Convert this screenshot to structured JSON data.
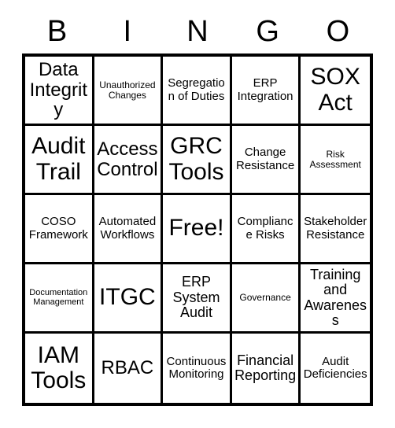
{
  "card": {
    "title": "BINGO",
    "header_letters": [
      "B",
      "I",
      "N",
      "G",
      "O"
    ],
    "free_space_label": "Free!",
    "colors": {
      "background": "#ffffff",
      "grid_line": "#000000",
      "text": "#000000"
    },
    "grid": {
      "rows": 5,
      "columns": 5,
      "cells": [
        {
          "text": "Data Integrity",
          "size": "lg",
          "free": false
        },
        {
          "text": "Unauthorized Changes",
          "size": "xs",
          "free": false
        },
        {
          "text": "Segregation of Duties",
          "size": "sm",
          "free": false
        },
        {
          "text": "ERP Integration",
          "size": "sm",
          "free": false
        },
        {
          "text": "SOX Act",
          "size": "xl",
          "free": false
        },
        {
          "text": "Audit Trail",
          "size": "xl",
          "free": false
        },
        {
          "text": "Access Control",
          "size": "lg",
          "free": false
        },
        {
          "text": "GRC Tools",
          "size": "xl",
          "free": false
        },
        {
          "text": "Change Resistance",
          "size": "sm",
          "free": false
        },
        {
          "text": "Risk Assessment",
          "size": "xs",
          "free": false
        },
        {
          "text": "COSO Framework",
          "size": "sm",
          "free": false
        },
        {
          "text": "Automated Workflows",
          "size": "sm",
          "free": false
        },
        {
          "text": "Free!",
          "size": "xl",
          "free": true
        },
        {
          "text": "Compliance Risks",
          "size": "sm",
          "free": false
        },
        {
          "text": "Stakeholder Resistance",
          "size": "sm",
          "free": false
        },
        {
          "text": "Documentation Management",
          "size": "xxs",
          "free": false
        },
        {
          "text": "ITGC",
          "size": "xl",
          "free": false
        },
        {
          "text": "ERP System Audit",
          "size": "md",
          "free": false
        },
        {
          "text": "Governance",
          "size": "xs",
          "free": false
        },
        {
          "text": "Training and Awareness",
          "size": "md",
          "free": false
        },
        {
          "text": "IAM Tools",
          "size": "xl",
          "free": false
        },
        {
          "text": "RBAC",
          "size": "lg",
          "free": false
        },
        {
          "text": "Continuous Monitoring",
          "size": "sm",
          "free": false
        },
        {
          "text": "Financial Reporting",
          "size": "md",
          "free": false
        },
        {
          "text": "Audit Deficiencies",
          "size": "sm",
          "free": false
        }
      ]
    }
  }
}
